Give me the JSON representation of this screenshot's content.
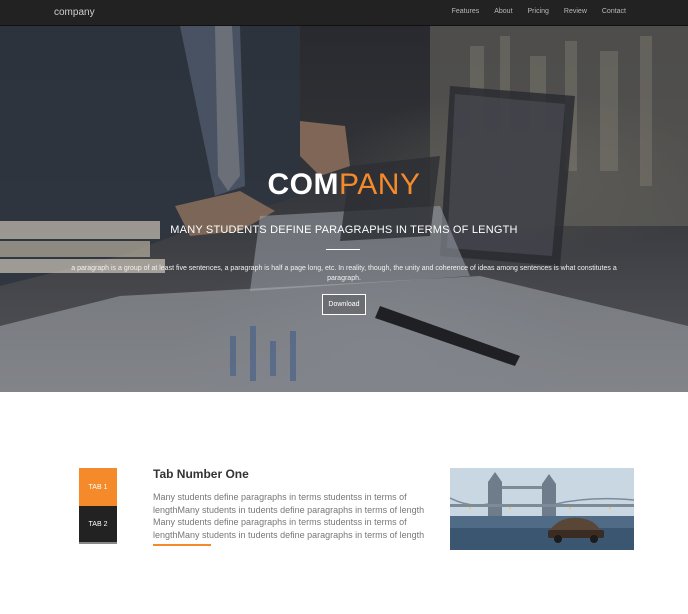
{
  "navbar": {
    "brand": "company",
    "links": [
      "Features",
      "About",
      "Pricing",
      "Review",
      "Contact"
    ]
  },
  "hero": {
    "title_white": "COM",
    "title_orange": "PANY",
    "subtitle": "MANY STUDENTS DEFINE PARAGRAPHS IN TERMS OF LENGTH",
    "paragraph": "a paragraph is a group of at least five sentences, a paragraph is half a page long, etc. In reality, though, the unity and coherence of ideas among sentences is what constitutes a paragraph.",
    "button": "Download"
  },
  "tabs": {
    "items": [
      "TAB 1",
      "TAB 2"
    ],
    "heading": "Tab Number One",
    "text": "Many students define paragraphs in terms studentss in terms of lengthMany students in tudents define paragraphs in terms of length Many students define paragraphs in terms studentss in terms of lengthMany students in tudents define paragraphs in terms of length"
  },
  "colors": {
    "accent": "#f58a2b",
    "navbar": "#222222"
  }
}
